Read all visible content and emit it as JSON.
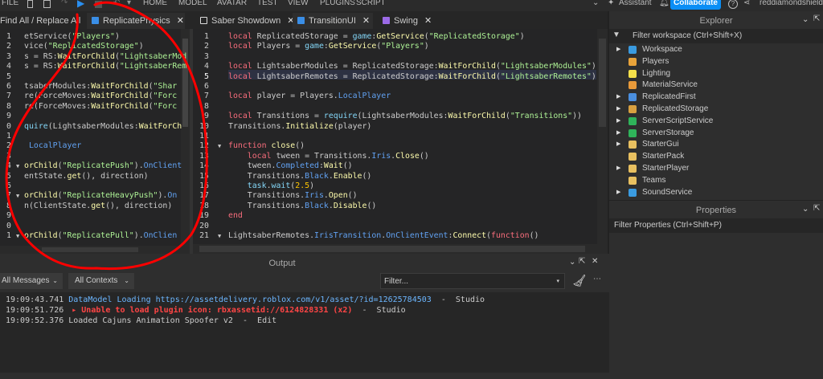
{
  "topbar": {
    "file": "FILE",
    "menu": [
      "HOME",
      "MODEL",
      "AVATAR",
      "TEST",
      "VIEW",
      "PLUGINS",
      "SCRIPT"
    ],
    "assistant": "Assistant",
    "collaborate": "Collaborate",
    "user": "reddiamondshield",
    "accent": "#0b8ef5"
  },
  "tabs": [
    {
      "label": "Find All / Replace All",
      "icon": "search-results-icon",
      "color": ""
    },
    {
      "label": "ReplicatePhysics",
      "icon": "local-script-icon",
      "color": "#3a8ee6",
      "active": true
    },
    {
      "label": "Saber Showdown",
      "icon": "place-icon",
      "color": "#dddddd"
    },
    {
      "label": "TransitionUI",
      "icon": "local-script-icon",
      "color": "#3a8ee6",
      "active": true
    },
    {
      "label": "Swing",
      "icon": "module-script-icon",
      "color": "#9b6ae6"
    }
  ],
  "left_editor": {
    "line_numbers": [
      "1",
      "2",
      "3",
      "4",
      "5",
      "6",
      "7",
      "8",
      "9",
      "0",
      "1",
      "2",
      "3",
      "4",
      "5",
      "6",
      "7",
      "8",
      "9",
      "0",
      "1"
    ],
    "lines": [
      [
        [
          "i",
          "etService("
        ],
        [
          "s",
          "\"Players\""
        ],
        [
          "i",
          ")"
        ]
      ],
      [
        [
          "i",
          "vice("
        ],
        [
          "s",
          "\"ReplicatedStorage\""
        ],
        [
          "i",
          ")"
        ]
      ],
      [
        [
          "i",
          "s = RS:"
        ],
        [
          "m",
          "WaitForChild"
        ],
        [
          "i",
          "("
        ],
        [
          "s",
          "\"LightsaberMod"
        ]
      ],
      [
        [
          "i",
          "s = RS:"
        ],
        [
          "m",
          "WaitForChild"
        ],
        [
          "i",
          "("
        ],
        [
          "s",
          "\"LightsaberRem"
        ]
      ],
      [],
      [
        [
          "i",
          "tsaberModules:"
        ],
        [
          "m",
          "WaitForChild"
        ],
        [
          "i",
          "("
        ],
        [
          "s",
          "\"Shar"
        ]
      ],
      [
        [
          "i",
          "re(ForceMoves:"
        ],
        [
          "m",
          "WaitForChild"
        ],
        [
          "i",
          "("
        ],
        [
          "s",
          "\"Forc"
        ]
      ],
      [
        [
          "i",
          "re(ForceMoves:"
        ],
        [
          "m",
          "WaitForChild"
        ],
        [
          "i",
          "("
        ],
        [
          "s",
          "\"Forc"
        ]
      ],
      [],
      [
        [
          "b",
          "quire"
        ],
        [
          "i",
          "(LightsaberModules:"
        ],
        [
          "m",
          "WaitForCh"
        ]
      ],
      [],
      [
        [
          "p",
          " LocalPlayer"
        ]
      ],
      [],
      [
        [
          "m",
          "orChild"
        ],
        [
          "i",
          "("
        ],
        [
          "s",
          "\"ReplicatePush\""
        ],
        [
          "i",
          ")."
        ],
        [
          "p",
          "OnClient"
        ]
      ],
      [
        [
          "i",
          "entState."
        ],
        [
          "m",
          "get"
        ],
        [
          "i",
          "(), direction)"
        ]
      ],
      [],
      [
        [
          "m",
          "orChild"
        ],
        [
          "i",
          "("
        ],
        [
          "s",
          "\"ReplicateHeavyPush\""
        ],
        [
          "i",
          ")."
        ],
        [
          "p",
          "On"
        ]
      ],
      [
        [
          "i",
          "n(ClientState."
        ],
        [
          "m",
          "get"
        ],
        [
          "i",
          "(), direction)"
        ]
      ],
      [],
      [],
      [
        [
          "m",
          "orChild"
        ],
        [
          "i",
          "("
        ],
        [
          "s",
          "\"ReplicatePull\""
        ],
        [
          "i",
          ")."
        ],
        [
          "p",
          "OnClien"
        ]
      ]
    ],
    "folds": [
      14,
      17,
      21
    ]
  },
  "main_editor": {
    "line_numbers": [
      "1",
      "2",
      "3",
      "4",
      "5",
      "6",
      "7",
      "8",
      "9",
      "10",
      "11",
      "12",
      "13",
      "14",
      "15",
      "16",
      "17",
      "18",
      "19",
      "20",
      "21"
    ],
    "current_line": 5,
    "lines": [
      [
        [
          "k",
          "local"
        ],
        [
          "i",
          " ReplicatedStorage = "
        ],
        [
          "b",
          "game"
        ],
        [
          "i",
          ":"
        ],
        [
          "m",
          "GetService"
        ],
        [
          "i",
          "("
        ],
        [
          "s",
          "\"ReplicatedStorage\""
        ],
        [
          "i",
          ")"
        ]
      ],
      [
        [
          "k",
          "local"
        ],
        [
          "i",
          " Players = "
        ],
        [
          "b",
          "game"
        ],
        [
          "i",
          ":"
        ],
        [
          "m",
          "GetService"
        ],
        [
          "i",
          "("
        ],
        [
          "s",
          "\"Players\""
        ],
        [
          "i",
          ")"
        ]
      ],
      [],
      [
        [
          "k",
          "local"
        ],
        [
          "i",
          " LightsaberModules = ReplicatedStorage:"
        ],
        [
          "m",
          "WaitForChild"
        ],
        [
          "i",
          "("
        ],
        [
          "s",
          "\"LightsaberModules\""
        ],
        [
          "i",
          ")"
        ]
      ],
      [
        [
          "k",
          "local"
        ],
        [
          "i",
          " LightsaberRemotes = ReplicatedStorage:"
        ],
        [
          "m",
          "WaitForChild"
        ],
        [
          "i",
          "("
        ],
        [
          "s",
          "\"LightsaberRemotes\""
        ],
        [
          "i",
          ")"
        ]
      ],
      [],
      [
        [
          "k",
          "local"
        ],
        [
          "i",
          " player = Players."
        ],
        [
          "p",
          "LocalPlayer"
        ]
      ],
      [],
      [
        [
          "k",
          "local"
        ],
        [
          "i",
          " Transitions = "
        ],
        [
          "b",
          "require"
        ],
        [
          "i",
          "(LightsaberModules:"
        ],
        [
          "m",
          "WaitForChild"
        ],
        [
          "i",
          "("
        ],
        [
          "s",
          "\"Transitions\""
        ],
        [
          "i",
          "))"
        ]
      ],
      [
        [
          "i",
          "Transitions."
        ],
        [
          "m",
          "Initialize"
        ],
        [
          "i",
          "(player)"
        ]
      ],
      [],
      [
        [
          "k",
          "function"
        ],
        [
          "m",
          " close"
        ],
        [
          "i",
          "()"
        ]
      ],
      [
        [
          "i",
          "    "
        ],
        [
          "k",
          "local"
        ],
        [
          "i",
          " tween = Transitions."
        ],
        [
          "p",
          "Iris"
        ],
        [
          "i",
          "."
        ],
        [
          "m",
          "Close"
        ],
        [
          "i",
          "()"
        ]
      ],
      [
        [
          "i",
          "    tween."
        ],
        [
          "p",
          "Completed"
        ],
        [
          "i",
          ":"
        ],
        [
          "m",
          "Wait"
        ],
        [
          "i",
          "()"
        ]
      ],
      [
        [
          "i",
          "    Transitions."
        ],
        [
          "p",
          "Black"
        ],
        [
          "i",
          "."
        ],
        [
          "m",
          "Enable"
        ],
        [
          "i",
          "()"
        ]
      ],
      [
        [
          "i",
          "    "
        ],
        [
          "b",
          "task"
        ],
        [
          "i",
          "."
        ],
        [
          "b",
          "wait"
        ],
        [
          "i",
          "("
        ],
        [
          "n",
          "2.5"
        ],
        [
          "i",
          ")"
        ]
      ],
      [
        [
          "i",
          "    Transitions."
        ],
        [
          "p",
          "Iris"
        ],
        [
          "i",
          "."
        ],
        [
          "m",
          "Open"
        ],
        [
          "i",
          "()"
        ]
      ],
      [
        [
          "i",
          "    Transitions."
        ],
        [
          "p",
          "Black"
        ],
        [
          "i",
          "."
        ],
        [
          "m",
          "Disable"
        ],
        [
          "i",
          "()"
        ]
      ],
      [
        [
          "k",
          "end"
        ]
      ],
      [],
      [
        [
          "i",
          "LightsaberRemotes."
        ],
        [
          "p",
          "IrisTransition"
        ],
        [
          "i",
          "."
        ],
        [
          "p",
          "OnClientEvent"
        ],
        [
          "i",
          ":"
        ],
        [
          "m",
          "Connect"
        ],
        [
          "i",
          "("
        ],
        [
          "k",
          "function"
        ],
        [
          "i",
          "()"
        ]
      ]
    ],
    "folds": [
      12,
      21
    ]
  },
  "explorer": {
    "title": "Explorer",
    "filter": "Filter workspace (Ctrl+Shift+X)",
    "items": [
      {
        "label": "Workspace",
        "expandable": true,
        "icon": "workspace-icon",
        "color": "#3a9be0"
      },
      {
        "label": "Players",
        "expandable": false,
        "icon": "players-icon",
        "color": "#e8a33a"
      },
      {
        "label": "Lighting",
        "expandable": false,
        "icon": "lighting-icon",
        "color": "#f5e04a"
      },
      {
        "label": "MaterialService",
        "expandable": false,
        "icon": "material-service-icon",
        "color": "#e89a3a"
      },
      {
        "label": "ReplicatedFirst",
        "expandable": true,
        "icon": "replicated-first-icon",
        "color": "#4a8fe0"
      },
      {
        "label": "ReplicatedStorage",
        "expandable": true,
        "icon": "replicated-storage-icon",
        "color": "#d8a040"
      },
      {
        "label": "ServerScriptService",
        "expandable": true,
        "icon": "server-script-service-icon",
        "color": "#2fb35a"
      },
      {
        "label": "ServerStorage",
        "expandable": true,
        "icon": "server-storage-icon",
        "color": "#2fb35a"
      },
      {
        "label": "StarterGui",
        "expandable": true,
        "icon": "starter-gui-icon",
        "color": "#e8c060"
      },
      {
        "label": "StarterPack",
        "expandable": false,
        "icon": "starter-pack-icon",
        "color": "#e8c060"
      },
      {
        "label": "StarterPlayer",
        "expandable": true,
        "icon": "starter-player-icon",
        "color": "#e8c060"
      },
      {
        "label": "Teams",
        "expandable": false,
        "icon": "teams-icon",
        "color": "#e8c060"
      },
      {
        "label": "SoundService",
        "expandable": true,
        "icon": "sound-service-icon",
        "color": "#3a9be0"
      }
    ]
  },
  "properties": {
    "title": "Properties",
    "filter": "Filter Properties (Ctrl+Shift+P)"
  },
  "output": {
    "title": "Output",
    "messages_filter": "All Messages",
    "contexts_filter": "All Contexts",
    "filter_placeholder": "Filter...",
    "logs": [
      {
        "time": "19:09:43.741",
        "text": "DataModel Loading https://assetdelivery.roblox.com/v1/asset/?id=12625784503",
        "source": "  -  Studio",
        "kind": "info",
        "color": "#6cb6ff"
      },
      {
        "time": "19:09:51.726",
        "text": "▸ Unable to load plugin icon: rbxassetid://6124828331 (x2)",
        "source": "  -  Studio",
        "kind": "error",
        "color": "#ff4545"
      },
      {
        "time": "19:09:52.376",
        "text": "Loaded Cajuns Animation Spoofer v2",
        "source": "  -  Edit",
        "kind": "normal",
        "color": "#cccccc"
      }
    ]
  },
  "annotation_color": "#ff0000"
}
